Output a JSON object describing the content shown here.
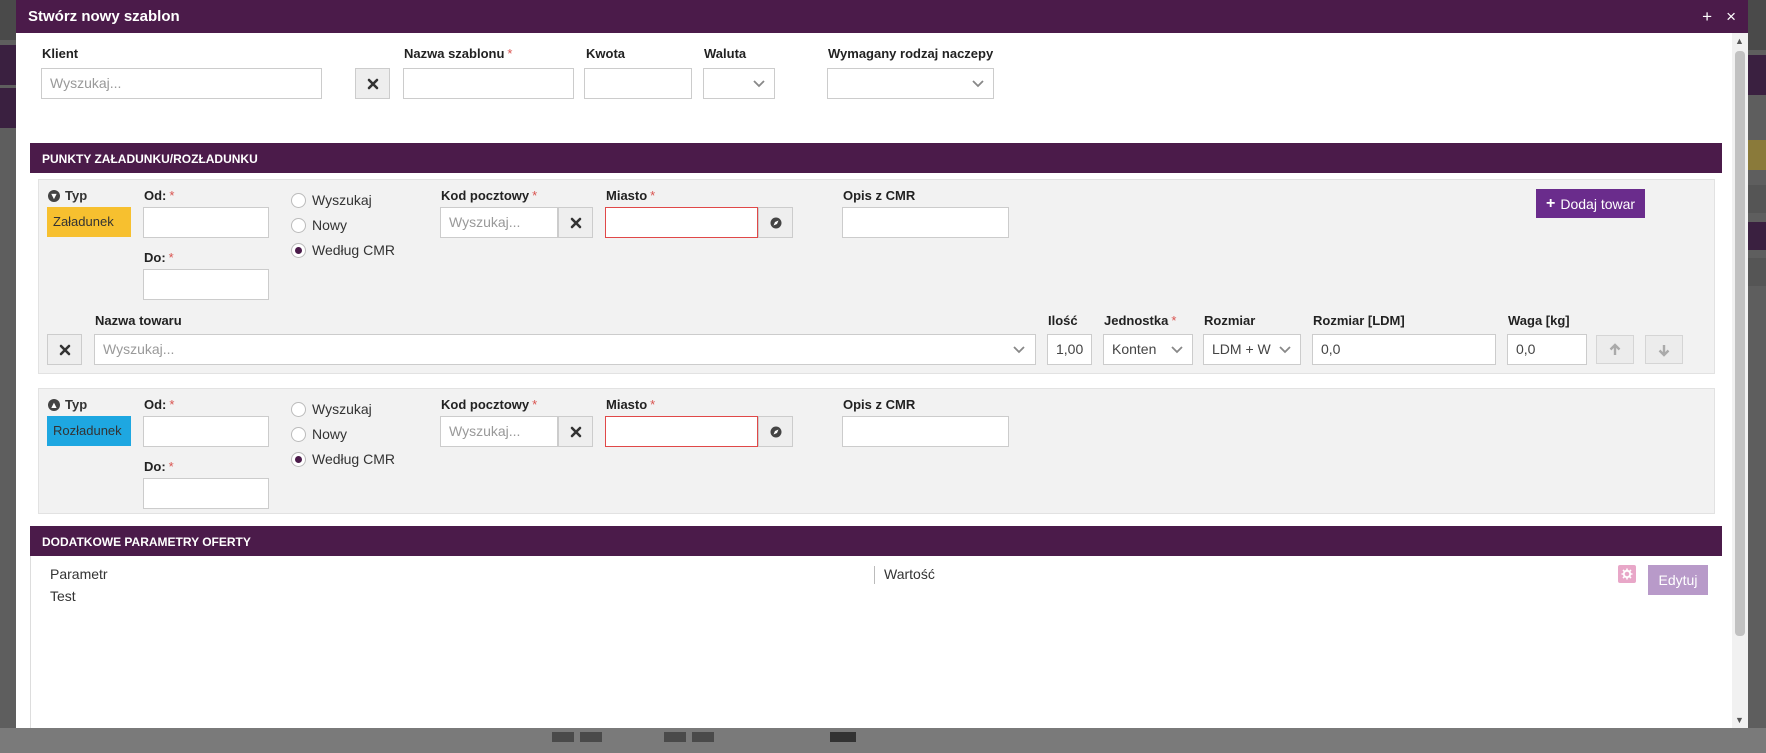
{
  "modal": {
    "title": "Stwórz nowy szablon",
    "expand_label": "+",
    "close_label": "×"
  },
  "top_form": {
    "client_label": "Klient",
    "client_placeholder": "Wyszukaj...",
    "template_name_label": "Nazwa szablonu",
    "amount_label": "Kwota",
    "currency_label": "Waluta",
    "trailer_label": "Wymagany rodzaj naczepy"
  },
  "loading_section": {
    "title": "PUNKTY ZAŁADUNKU/ROZŁADUNKU"
  },
  "point_labels": {
    "type": "Typ",
    "from": "Od:",
    "to": "Do:",
    "postal_code": "Kod pocztowy",
    "city": "Miasto",
    "cmr_description": "Opis z CMR",
    "postal_placeholder": "Wyszukaj...",
    "radio_options": [
      "Wyszukaj",
      "Nowy",
      "Według CMR"
    ],
    "selected_radio": "Według CMR"
  },
  "points": [
    {
      "type": "Załadunek",
      "color": "#f7c02f",
      "toggle": "down"
    },
    {
      "type": "Rozładunek",
      "color": "#1ea7e1",
      "toggle": "up"
    }
  ],
  "add_goods_label": "Dodaj towar",
  "goods": {
    "name_label": "Nazwa towaru",
    "name_placeholder": "Wyszukaj...",
    "quantity_label": "Ilość",
    "quantity_value": "1,00",
    "unit_label": "Jednostka",
    "unit_value": "Konten",
    "size_label": "Rozmiar",
    "size_value": "LDM + W",
    "size_ldm_label": "Rozmiar [LDM]",
    "size_ldm_value": "0,0",
    "weight_label": "Waga [kg]",
    "weight_value": "0,0"
  },
  "extra_section": {
    "title": "DODATKOWE PARAMETRY OFERTY",
    "param_header": "Parametr",
    "value_header": "Wartość",
    "rows": [
      {
        "param": "Test",
        "value": ""
      }
    ],
    "edit_label": "Edytuj"
  },
  "colors": {
    "accent": "#4b1b4a",
    "add_button": "#6a2c8c",
    "loading": "#f7c02f",
    "unloading": "#1ea7e1",
    "required": "#d9534f"
  }
}
